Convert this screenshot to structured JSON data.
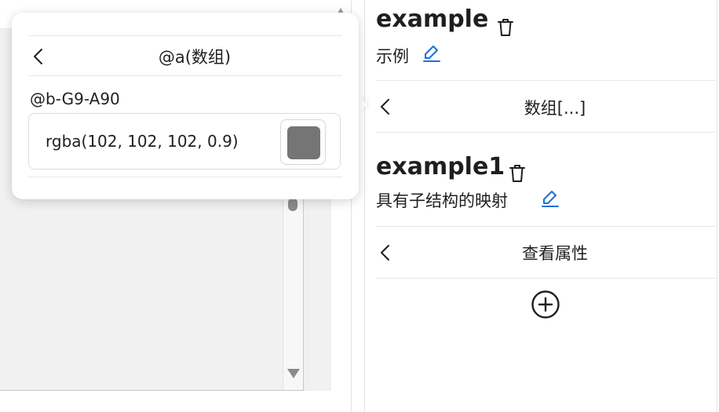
{
  "popover": {
    "title": "@a(数组)",
    "subtitle": "@b-G9-A90",
    "color_value": "rgba(102, 102, 102, 0.9)",
    "swatch_color": "rgba(102, 102, 102, 0.9)"
  },
  "panel": {
    "item1": {
      "title": "example",
      "subtitle": "示例"
    },
    "nav1_label": "数组[...]",
    "item2": {
      "title": "example1",
      "subtitle": "具有子结构的映射"
    },
    "nav2_label": "查看属性"
  },
  "colors": {
    "accent": "#1e6fd9",
    "text": "#1f1f1f",
    "swatch": "#666666"
  },
  "icons": [
    "chevron-left-icon",
    "trash-icon",
    "edit-icon",
    "plus-circle-icon"
  ]
}
